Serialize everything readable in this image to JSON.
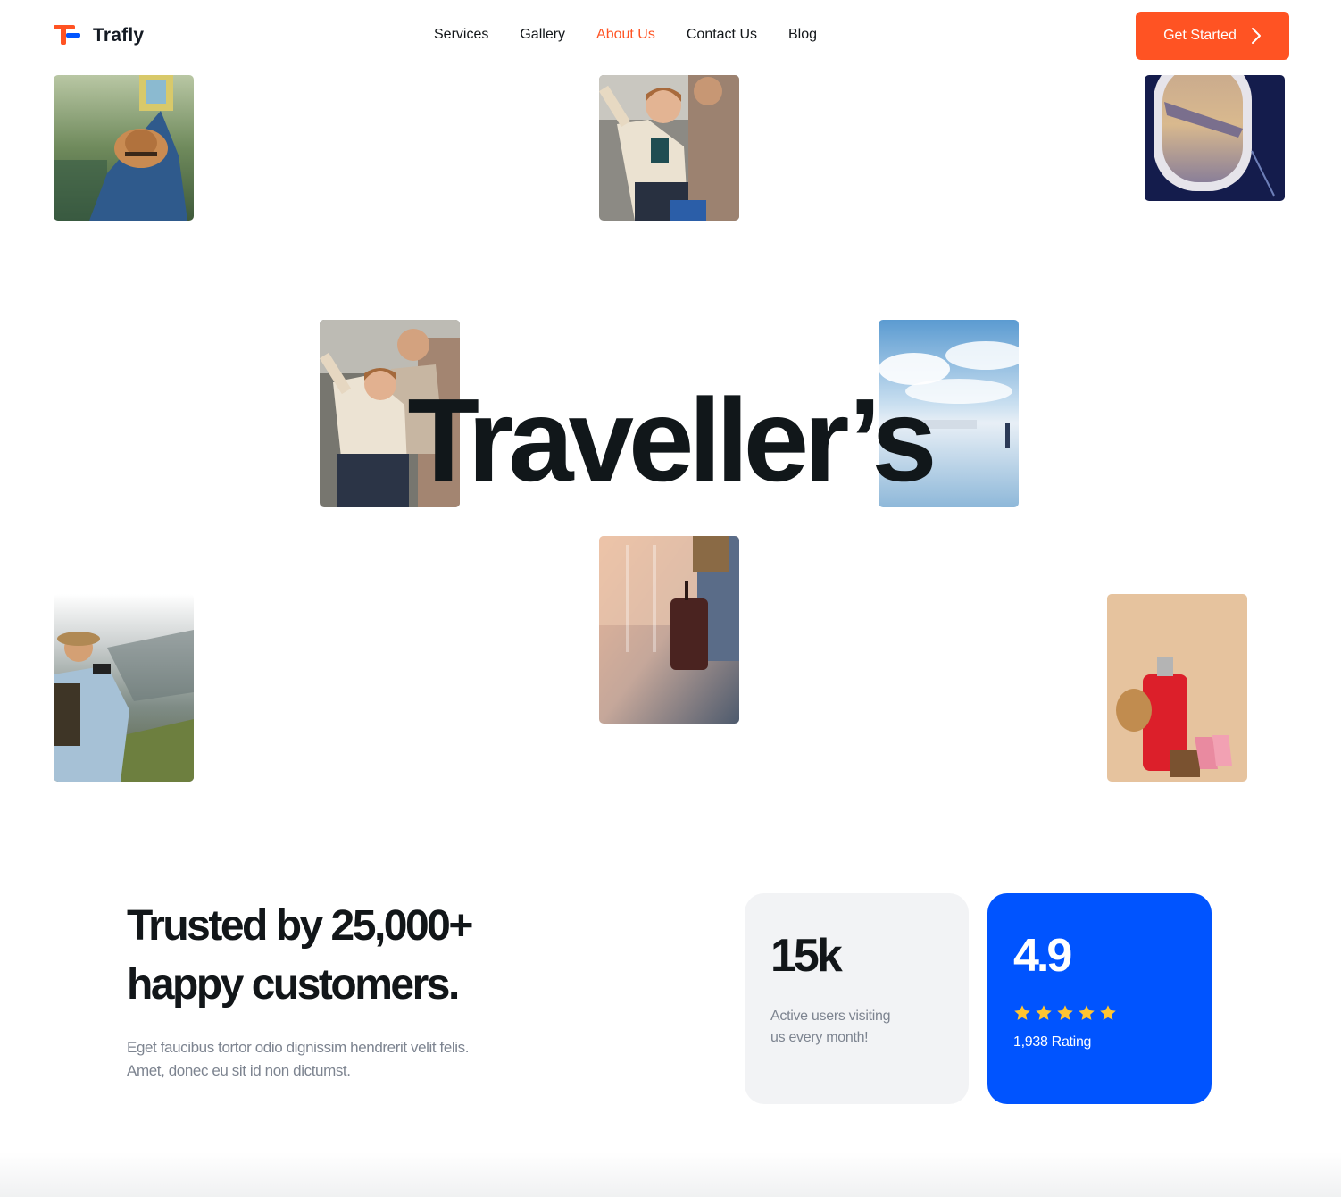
{
  "header": {
    "logo_text": "Trafly",
    "nav": [
      {
        "label": "Services",
        "active": false
      },
      {
        "label": "Gallery",
        "active": false
      },
      {
        "label": "About Us",
        "active": true
      },
      {
        "label": "Contact Us",
        "active": false
      },
      {
        "label": "Blog",
        "active": false
      }
    ],
    "cta_label": "Get Started"
  },
  "hero": {
    "word": "Traveller’s"
  },
  "stats": {
    "headline_line1": "Trusted by 25,000+",
    "headline_line2": "happy customers.",
    "subtext_line1": "Eget faucibus tortor odio dignissim hendrerit velit felis.",
    "subtext_line2": "Amet, donec eu sit id non dictumst.",
    "users_card": {
      "value": "15k",
      "desc_line1": "Active users visiting",
      "desc_line2": "us every month!"
    },
    "rating_card": {
      "value": "4.9",
      "stars": 5,
      "rating_text": "1,938 Rating"
    }
  },
  "colors": {
    "accent_orange": "#ff5323",
    "accent_blue": "#0054ff",
    "star_yellow": "#ffc531",
    "text_dark": "#121619",
    "text_muted": "#7d8490"
  },
  "icons": [
    "logo-mark-icon",
    "chevron-right-icon",
    "star-icon"
  ]
}
